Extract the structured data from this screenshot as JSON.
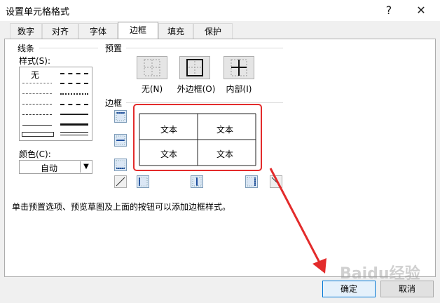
{
  "window": {
    "title": "设置单元格格式",
    "help_label": "?",
    "close_label": "✕"
  },
  "tabs": [
    {
      "label": "数字"
    },
    {
      "label": "对齐"
    },
    {
      "label": "字体"
    },
    {
      "label": "边框",
      "active": true
    },
    {
      "label": "填充"
    },
    {
      "label": "保护"
    }
  ],
  "line": {
    "group_label": "线条",
    "style_label": "样式(S):",
    "none_label": "无",
    "color_label": "颜色(C):",
    "color_value": "自动"
  },
  "presets": {
    "group_label": "预置",
    "items": [
      {
        "label": "无(N)",
        "icon": "border-none-icon"
      },
      {
        "label": "外边框(O)",
        "icon": "border-outline-icon"
      },
      {
        "label": "内部(I)",
        "icon": "border-inside-icon"
      }
    ]
  },
  "border": {
    "group_label": "边框",
    "cell_text": [
      "文本",
      "文本",
      "文本",
      "文本"
    ]
  },
  "hint": "单击预置选项、预览草图及上面的按钮可以添加边框样式。",
  "buttons": {
    "ok": "确定",
    "cancel": "取消"
  },
  "colors": {
    "highlight_red": "#e32b2b",
    "accent_blue": "#0078d7"
  },
  "watermark": "Baidu经验"
}
